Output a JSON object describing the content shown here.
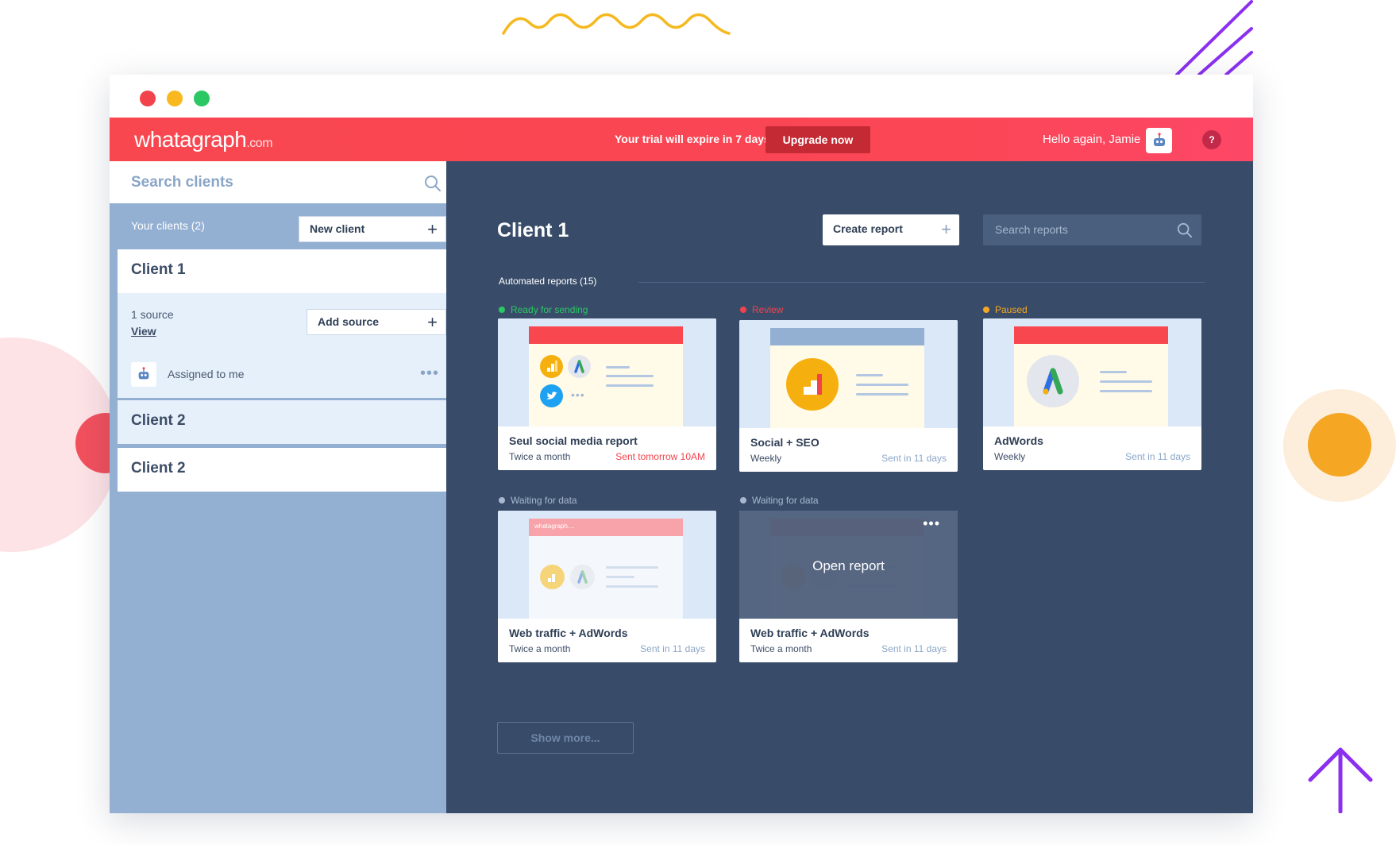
{
  "colors": {
    "brand_red": "#f8474f",
    "sidebar_blue": "#93afd2",
    "main_navy": "#384c69",
    "status_ready": "#2bc764",
    "status_review": "#f2424c",
    "status_paused": "#f5a623",
    "status_waiting": "#a7b8cf"
  },
  "topbar": {
    "logo_main": "whatagraph",
    "logo_suffix": ".com",
    "trial_text": "Your trial will expire in 7 days",
    "upgrade_label": "Upgrade now",
    "greeting": "Hello again, Jamie",
    "avatar_icon": "robot-avatar-icon",
    "help_label": "?"
  },
  "sidebar": {
    "search_placeholder": "Search clients",
    "your_clients": "Your clients (2)",
    "new_client_label": "New client",
    "clients": [
      {
        "name": "Client 1",
        "source_count": "1 source",
        "view_label": "View",
        "add_source_label": "Add source",
        "assigned_label": "Assigned to me",
        "more": "•••"
      },
      {
        "name": "Client 2"
      },
      {
        "name": "Client 2"
      }
    ]
  },
  "main": {
    "title": "Client 1",
    "create_report_label": "Create report",
    "search_reports_placeholder": "Search reports",
    "automated_label": "Automated  reports (15)",
    "show_more_label": "Show more...",
    "reports": [
      {
        "status": "Ready for sending",
        "status_color": "#2bc764",
        "title": "Seul social media report",
        "frequency": "Twice a month",
        "send_info": "Sent tomorrow 10AM",
        "icons": [
          "analytics-icon",
          "adwords-icon",
          "twitter-icon"
        ]
      },
      {
        "status": "Review",
        "status_color": "#f2424c",
        "title": "Social + SEO",
        "frequency": "Weekly",
        "send_info": "Sent in 11 days",
        "icons": [
          "analytics-icon"
        ]
      },
      {
        "status": "Paused",
        "status_color": "#f5a623",
        "title": "AdWords",
        "frequency": "Weekly",
        "send_info": "Sent in 11 days",
        "icons": [
          "adwords-icon"
        ]
      },
      {
        "status": "Waiting for data",
        "status_color": "#a7b8cf",
        "title": "Web traffic + AdWords",
        "frequency": "Twice a month",
        "send_info": "Sent in 11 days",
        "thumb_header": "whatagraph....",
        "icons": [
          "analytics-icon",
          "adwords-icon"
        ]
      },
      {
        "status": "Waiting for data",
        "status_color": "#a7b8cf",
        "title": "Web traffic + AdWords",
        "frequency": "Twice a month",
        "send_info": "Sent in 11 days",
        "overlay_label": "Open report",
        "more": "•••",
        "icons": [
          "analytics-icon",
          "adwords-icon"
        ]
      }
    ]
  }
}
